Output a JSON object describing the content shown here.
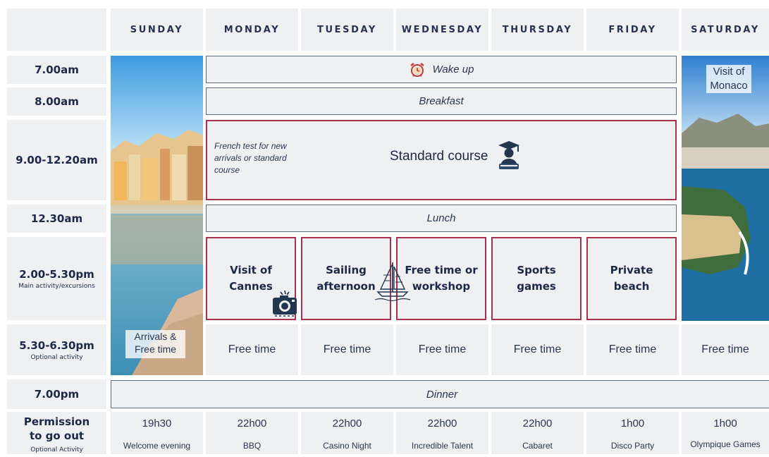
{
  "days": [
    "SUNDAY",
    "MONDAY",
    "TUESDAY",
    "WEDNESDAY",
    "THURSDAY",
    "FRIDAY",
    "SATURDAY"
  ],
  "times": {
    "wake": "7.00am",
    "breakfast": "8.00am",
    "course": "9.00-12.20am",
    "lunch": "12.30am",
    "activity": "2.00-5.30pm",
    "activity_sub": "Main activity/excursions",
    "optional": "5.30-6.30pm",
    "optional_sub": "Optional activity",
    "dinner": "7.00pm",
    "permission_line1": "Permission",
    "permission_line2": "to go out",
    "permission_sub": "Optional Activity"
  },
  "bars": {
    "wake_up": "Wake up",
    "breakfast": "Breakfast",
    "lunch": "Lunch",
    "dinner": "Dinner"
  },
  "course": {
    "note": "French test for new arrivals or standard course",
    "title": "Standard course"
  },
  "sunday_note": "Arrivals & Free time",
  "saturday_note": "Visit of Monaco",
  "activities": [
    {
      "line1": "Visit of",
      "line2": "Cannes"
    },
    {
      "line1": "Sailing",
      "line2": "afternoon"
    },
    {
      "line1": "Free time or",
      "line2": "workshop"
    },
    {
      "line1": "Sports",
      "line2": "games"
    },
    {
      "line1": "Private",
      "line2": "beach"
    }
  ],
  "free_time": [
    "Free time",
    "Free time",
    "Free time",
    "Free time",
    "Free time",
    "Free time"
  ],
  "evening": [
    {
      "time": "19h30",
      "label": "Welcome evening"
    },
    {
      "time": "22h00",
      "label": "BBQ"
    },
    {
      "time": "22h00",
      "label": "Casino Night"
    },
    {
      "time": "22h00",
      "label": "Incredible Talent"
    },
    {
      "time": "22h00",
      "label": "Cabaret"
    },
    {
      "time": "1h00",
      "label": "Disco Party"
    },
    {
      "time": "1h00",
      "label": "Olympique Games"
    }
  ],
  "icons": [
    "alarm-clock-icon",
    "graduate-icon",
    "camera-icon",
    "sailboat-icon"
  ],
  "colors": {
    "accent": "#a8324e",
    "text": "#1f2e4d",
    "cell": "#eef0f2"
  }
}
